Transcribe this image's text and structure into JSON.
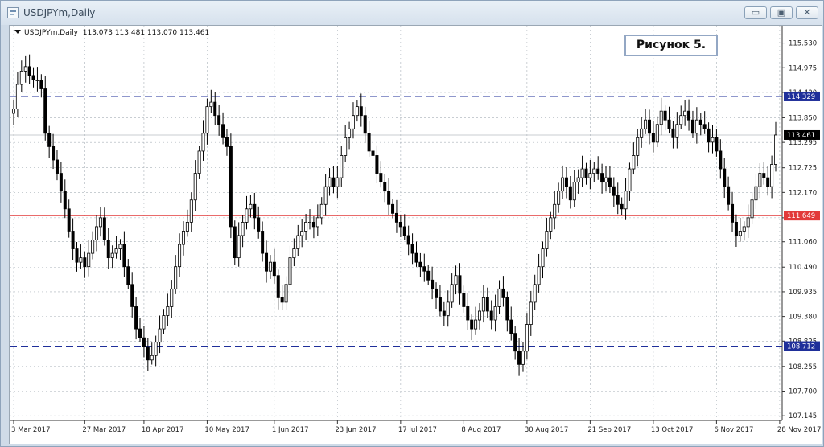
{
  "window": {
    "title": "USDJPYm,Daily",
    "buttons": {
      "minimize": "▭",
      "maximize": "▣",
      "close": "✕"
    }
  },
  "chart_data": {
    "type": "candlestick",
    "legend": {
      "symbol": "USDJPYm,Daily",
      "ohlc": "113.073 113.481 113.070 113.461"
    },
    "annotation": "Рисунок 5.",
    "current_price": 113.461,
    "y_ticks": [
      115.53,
      114.975,
      114.42,
      113.85,
      113.295,
      112.725,
      112.17,
      111.6,
      111.06,
      110.49,
      109.935,
      109.38,
      108.825,
      108.255,
      107.7,
      107.145
    ],
    "ylim": [
      107.04,
      115.92
    ],
    "x_ticks": [
      {
        "label": "3 Mar 2017",
        "index": 0
      },
      {
        "label": "27 Mar 2017",
        "index": 18
      },
      {
        "label": "18 Apr 2017",
        "index": 33
      },
      {
        "label": "10 May 2017",
        "index": 49
      },
      {
        "label": "1 Jun 2017",
        "index": 66
      },
      {
        "label": "23 Jun 2017",
        "index": 82
      },
      {
        "label": "17 Jul 2017",
        "index": 98
      },
      {
        "label": "8 Aug 2017",
        "index": 114
      },
      {
        "label": "30 Aug 2017",
        "index": 130
      },
      {
        "label": "21 Sep 2017",
        "index": 146
      },
      {
        "label": "13 Oct 2017",
        "index": 162
      },
      {
        "label": "6 Nov 2017",
        "index": 178
      },
      {
        "label": "28 Nov 2017",
        "index": 194
      }
    ],
    "levels": [
      {
        "price": 114.329,
        "label": "114.329",
        "style": "dashed",
        "color": "#1f2f9a"
      },
      {
        "price": 111.649,
        "label": "111.649",
        "style": "solid",
        "color": "#e23a3a"
      },
      {
        "price": 108.712,
        "label": "108.712",
        "style": "dashed",
        "color": "#1f2f9a"
      }
    ],
    "colors": {
      "candle": "#000000",
      "grid": "#a8b0b8",
      "price_tag": "#000000",
      "level_tag": "#1f2f9a",
      "red_tag": "#e23a3a"
    },
    "closes": [
      114.05,
      114.6,
      114.9,
      115.0,
      114.8,
      114.7,
      114.7,
      114.5,
      113.5,
      113.2,
      112.9,
      112.6,
      112.2,
      111.8,
      111.3,
      110.9,
      110.6,
      110.7,
      110.5,
      110.8,
      111.1,
      111.4,
      111.6,
      111.1,
      110.7,
      110.8,
      110.9,
      111.0,
      110.5,
      110.1,
      109.6,
      109.1,
      108.9,
      108.7,
      108.4,
      108.5,
      108.8,
      109.1,
      109.4,
      109.6,
      110.0,
      110.5,
      111.0,
      111.3,
      111.5,
      112.0,
      112.6,
      113.1,
      113.5,
      114.1,
      114.2,
      113.9,
      113.7,
      113.4,
      113.2,
      111.4,
      110.7,
      111.2,
      111.5,
      111.8,
      111.9,
      111.6,
      111.3,
      110.8,
      110.4,
      110.6,
      110.3,
      109.8,
      109.7,
      110.1,
      110.7,
      110.9,
      111.2,
      111.3,
      111.5,
      111.5,
      111.4,
      111.6,
      111.9,
      112.3,
      112.5,
      112.3,
      112.5,
      113.0,
      113.4,
      113.6,
      113.9,
      114.1,
      113.9,
      113.5,
      113.1,
      113.0,
      112.6,
      112.4,
      112.2,
      111.9,
      111.7,
      111.5,
      111.4,
      111.2,
      111.0,
      110.8,
      110.6,
      110.5,
      110.4,
      110.2,
      110.0,
      109.8,
      109.5,
      109.4,
      109.7,
      110.1,
      110.3,
      109.9,
      109.6,
      109.3,
      109.1,
      109.3,
      109.5,
      109.8,
      109.5,
      109.3,
      109.6,
      110.0,
      109.8,
      109.3,
      109.0,
      108.6,
      108.3,
      108.6,
      109.2,
      109.7,
      110.1,
      110.5,
      110.9,
      111.3,
      111.6,
      111.9,
      112.2,
      112.5,
      112.3,
      112.0,
      112.4,
      112.5,
      112.7,
      112.5,
      112.6,
      112.7,
      112.6,
      112.4,
      112.5,
      112.3,
      112.1,
      111.9,
      111.8,
      112.2,
      112.7,
      113.0,
      113.4,
      113.6,
      113.8,
      113.5,
      113.3,
      113.7,
      114.0,
      113.8,
      113.6,
      113.4,
      113.7,
      113.9,
      114.0,
      113.8,
      113.5,
      113.8,
      113.7,
      113.6,
      113.3,
      113.4,
      113.1,
      112.7,
      112.3,
      111.9,
      111.5,
      111.2,
      111.3,
      111.4,
      111.6,
      112.0,
      112.3,
      112.6,
      112.5,
      112.3,
      112.8,
      113.461
    ]
  }
}
